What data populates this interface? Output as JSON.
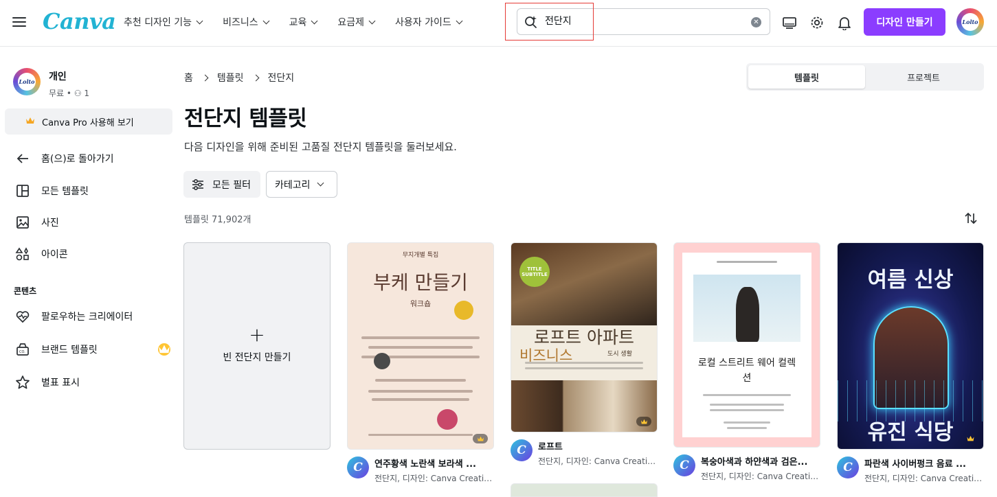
{
  "topbar": {
    "logo": "Canva",
    "nav": [
      "추천 디자인 기능",
      "비즈니스",
      "교육",
      "요금제",
      "사용자 가이드"
    ],
    "search_value": "전단지",
    "create_label": "디자인 만들기",
    "avatar_text": "Lolto"
  },
  "sidebar": {
    "profile_name": "개인",
    "profile_meta": "무료 • ⚇ 1",
    "pro_label": "Canva Pro 사용해 보기",
    "back_label": "홈(으)로 돌아가기",
    "items": [
      "모든 템플릿",
      "사진",
      "아이콘"
    ],
    "section_title": "콘텐츠",
    "content_items": [
      "팔로우하는 크리에이터",
      "브랜드 템플릿",
      "별표 표시"
    ]
  },
  "main": {
    "breadcrumb": [
      "홈",
      "템플릿",
      "전단지"
    ],
    "segment": [
      "템플릿",
      "프로젝트"
    ],
    "title": "전단지 템플릿",
    "subtitle": "다음 디자인을 위해 준비된 고품질 전단지 템플릿을 둘러보세요.",
    "filter_label": "모든 필터",
    "category_label": "카테고리",
    "count": "템플릿 71,902개",
    "blank_label": "빈 전단지 만들기"
  },
  "cards": [
    {
      "title": "연주황색 노란색 보라색 ...",
      "sub": "전단지, 디자인: Canva Creative...",
      "thumb_heading": "부케 만들기",
      "thumb_small": "워크숍",
      "thumb_top": "무지개별 특집"
    },
    {
      "title": "로프트",
      "sub": "전단지, 디자인: Canva Creative...",
      "thumb_heading": "로프트 아파트",
      "thumb_small": "비즈니스",
      "thumb_top": "TITLE SUBTITLE",
      "thumb_tag": "도시 생활"
    },
    {
      "title": "복숭아색과 하얀색과 검은...",
      "sub": "전단지, 디자인: Canva Creative...",
      "thumb_heading": "로컬 스트리트 웨어 컬렉션"
    },
    {
      "title": "파란색 사이버펑크 음료 ...",
      "sub": "전단지, 디자인: Canva Creative...",
      "thumb_heading": "여름 신상",
      "thumb_small": "유진 식당"
    }
  ],
  "colors": {
    "accent": "#8b3dff",
    "logo": "#22b3d3",
    "highlight": "#e53935"
  }
}
